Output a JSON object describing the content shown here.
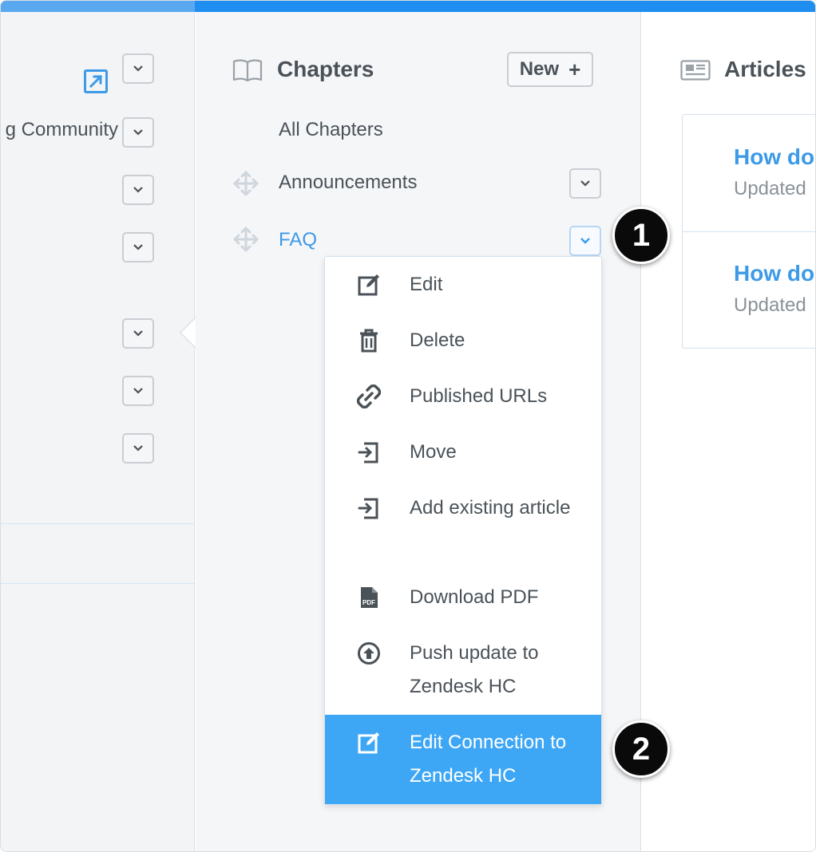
{
  "left_panel": {
    "partial_item_label": "g Community"
  },
  "chapters": {
    "title": "Chapters",
    "new_button_label": "New",
    "new_button_plus": "+",
    "all_label": "All Chapters",
    "items": [
      {
        "label": "Announcements"
      },
      {
        "label": "FAQ"
      }
    ]
  },
  "dropdown_menu": {
    "items": [
      {
        "label": "Edit",
        "icon": "edit-icon"
      },
      {
        "label": "Delete",
        "icon": "trash-icon"
      },
      {
        "label": "Published URLs",
        "icon": "link-icon"
      },
      {
        "label": "Move",
        "icon": "move-in-icon"
      },
      {
        "label": "Add existing article",
        "icon": "add-article-icon"
      },
      {
        "label": "Download PDF",
        "icon": "pdf-icon"
      },
      {
        "label": "Push update to Zendesk HC",
        "icon": "upload-icon"
      },
      {
        "label": "Edit Connection to Zendesk HC",
        "icon": "edit-icon"
      }
    ]
  },
  "articles": {
    "title": "Articles",
    "items": [
      {
        "title": "How do",
        "subtitle": "Updated"
      },
      {
        "title": "How do",
        "subtitle": "Updated"
      }
    ]
  },
  "callouts": {
    "one": "1",
    "two": "2"
  },
  "colors": {
    "accent": "#3d9ae8",
    "selected_bg": "#3ea7f5",
    "top_bar": "#1e8ff0"
  }
}
